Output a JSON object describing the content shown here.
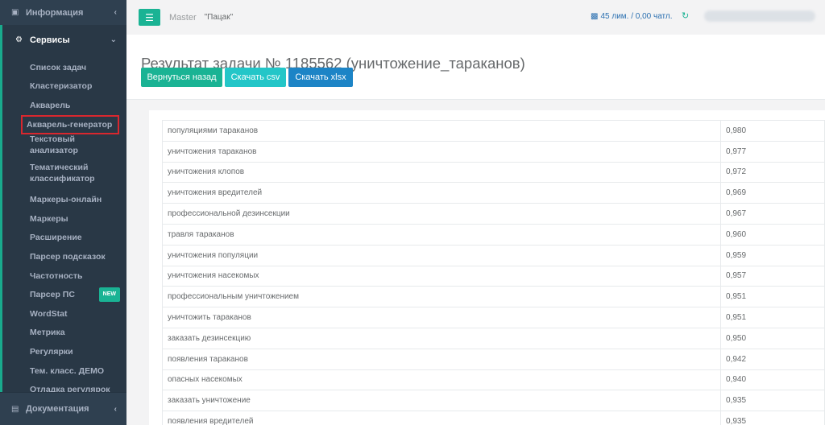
{
  "sidebar": {
    "top_item": {
      "label": "Информация",
      "icon": "briefcase-icon"
    },
    "section": {
      "label": "Сервисы",
      "icon": "cogs-icon"
    },
    "items": [
      {
        "label": "Список задач"
      },
      {
        "label": "Кластеризатор"
      },
      {
        "label": "Акварель"
      },
      {
        "label": "Акварель-генератор",
        "highlighted": true
      },
      {
        "label": "Текстовый анализатор"
      },
      {
        "label": "Тематический классификатор"
      },
      {
        "label": "Маркеры-онлайн"
      },
      {
        "label": "Маркеры"
      },
      {
        "label": "Расширение"
      },
      {
        "label": "Парсер подсказок"
      },
      {
        "label": "Частотность"
      },
      {
        "label": "Парсер ПС",
        "badge": "NEW"
      },
      {
        "label": "WordStat"
      },
      {
        "label": "Метрика"
      },
      {
        "label": "Регулярки"
      },
      {
        "label": "Тем. класс. ДЕМО"
      },
      {
        "label": "Отладка регулярок"
      }
    ],
    "bottom_item": {
      "label": "Документация",
      "icon": "book-icon"
    }
  },
  "topbar": {
    "master": "Master",
    "project": "\"Пацак\"",
    "limits": "45 лим. / 0,00 чатл."
  },
  "heading": {
    "title": "Результат задачи № 1185562 (уничтожение_тараканов)",
    "buttons": {
      "back": "Вернуться назад",
      "csv": "Скачать csv",
      "xlsx": "Скачать xlsx"
    }
  },
  "table": {
    "rows": [
      {
        "keyword": "популяциями тараканов",
        "score": "0,980"
      },
      {
        "keyword": "уничтожения тараканов",
        "score": "0,977"
      },
      {
        "keyword": "уничтожения клопов",
        "score": "0,972"
      },
      {
        "keyword": "уничтожения вредителей",
        "score": "0,969"
      },
      {
        "keyword": "профессиональной дезинсекции",
        "score": "0,967"
      },
      {
        "keyword": "травля тараканов",
        "score": "0,960"
      },
      {
        "keyword": "уничтожения популяции",
        "score": "0,959"
      },
      {
        "keyword": "уничтожения насекомых",
        "score": "0,957"
      },
      {
        "keyword": "профессиональным уничтожением",
        "score": "0,951"
      },
      {
        "keyword": "уничтожить тараканов",
        "score": "0,951"
      },
      {
        "keyword": "заказать дезинсекцию",
        "score": "0,950"
      },
      {
        "keyword": "появления тараканов",
        "score": "0,942"
      },
      {
        "keyword": "опасных насекомых",
        "score": "0,940"
      },
      {
        "keyword": "заказать уничтожение",
        "score": "0,935"
      },
      {
        "keyword": "появления вредителей",
        "score": "0,935"
      }
    ]
  },
  "colors": {
    "accent": "#1ab394",
    "sidebar": "#2f4050",
    "highlight": "#d9272e",
    "csv": "#23c6c8",
    "xlsx": "#1c84c6"
  }
}
